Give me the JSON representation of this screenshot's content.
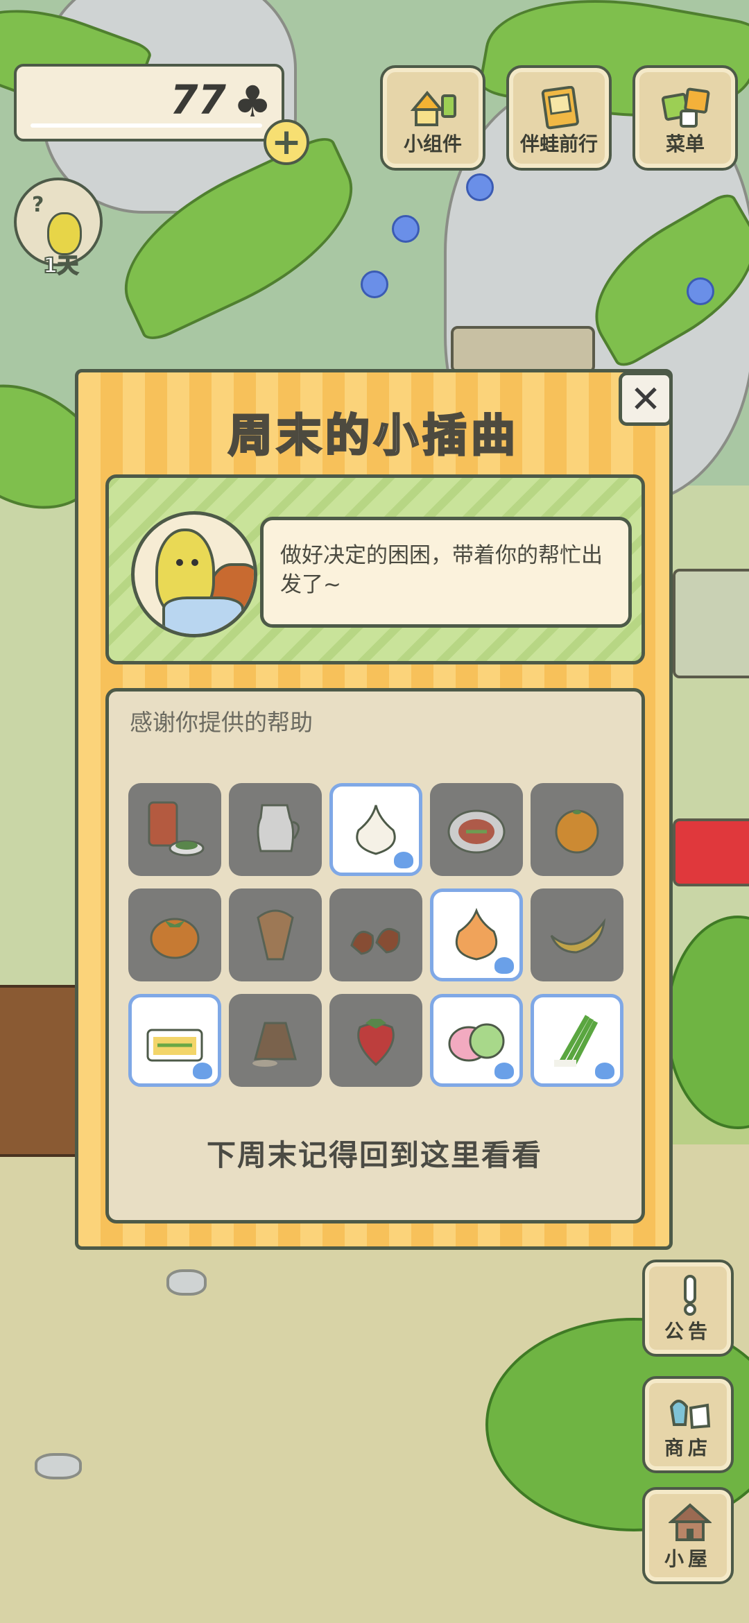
{
  "hud": {
    "clover_count": "77",
    "clover_symbol": "♣",
    "add_symbol": "+",
    "days_label": "1天"
  },
  "top_buttons": [
    {
      "label": "小组件",
      "icon": "widget-icon"
    },
    {
      "label": "伴蛙前行",
      "icon": "travel-book-icon"
    },
    {
      "label": "菜单",
      "icon": "menu-cards-icon"
    }
  ],
  "side_buttons": [
    {
      "label": "公告",
      "icon": "announcement-icon"
    },
    {
      "label": "商店",
      "icon": "shop-icon"
    },
    {
      "label": "小屋",
      "icon": "house-icon"
    }
  ],
  "dialog": {
    "title": "周末的小插曲",
    "close_symbol": "✕",
    "message": "做好决定的困困，带着你的帮忙出发了~",
    "items_caption": "感谢你提供的帮助",
    "footer": "下周末记得回到这里看看",
    "items": [
      {
        "name": "tea-can-and-greens",
        "selected": false
      },
      {
        "name": "milk-jug",
        "selected": false
      },
      {
        "name": "garlic",
        "selected": true
      },
      {
        "name": "salad-plate",
        "selected": false
      },
      {
        "name": "orange",
        "selected": false
      },
      {
        "name": "persimmon",
        "selected": false
      },
      {
        "name": "nut-bouquet",
        "selected": false
      },
      {
        "name": "chestnuts",
        "selected": false
      },
      {
        "name": "onion",
        "selected": true
      },
      {
        "name": "banana",
        "selected": false
      },
      {
        "name": "bento-box",
        "selected": true
      },
      {
        "name": "rice-sack",
        "selected": false
      },
      {
        "name": "strawberry",
        "selected": false
      },
      {
        "name": "mochi",
        "selected": true
      },
      {
        "name": "green-onion",
        "selected": true
      }
    ]
  },
  "colors": {
    "outline": "#4d5a48",
    "dialog_stripe_a": "#fbd37a",
    "dialog_stripe_b": "#f7c15a",
    "panel_green": "#c9e39a",
    "selected_border": "#7fa8e6"
  }
}
